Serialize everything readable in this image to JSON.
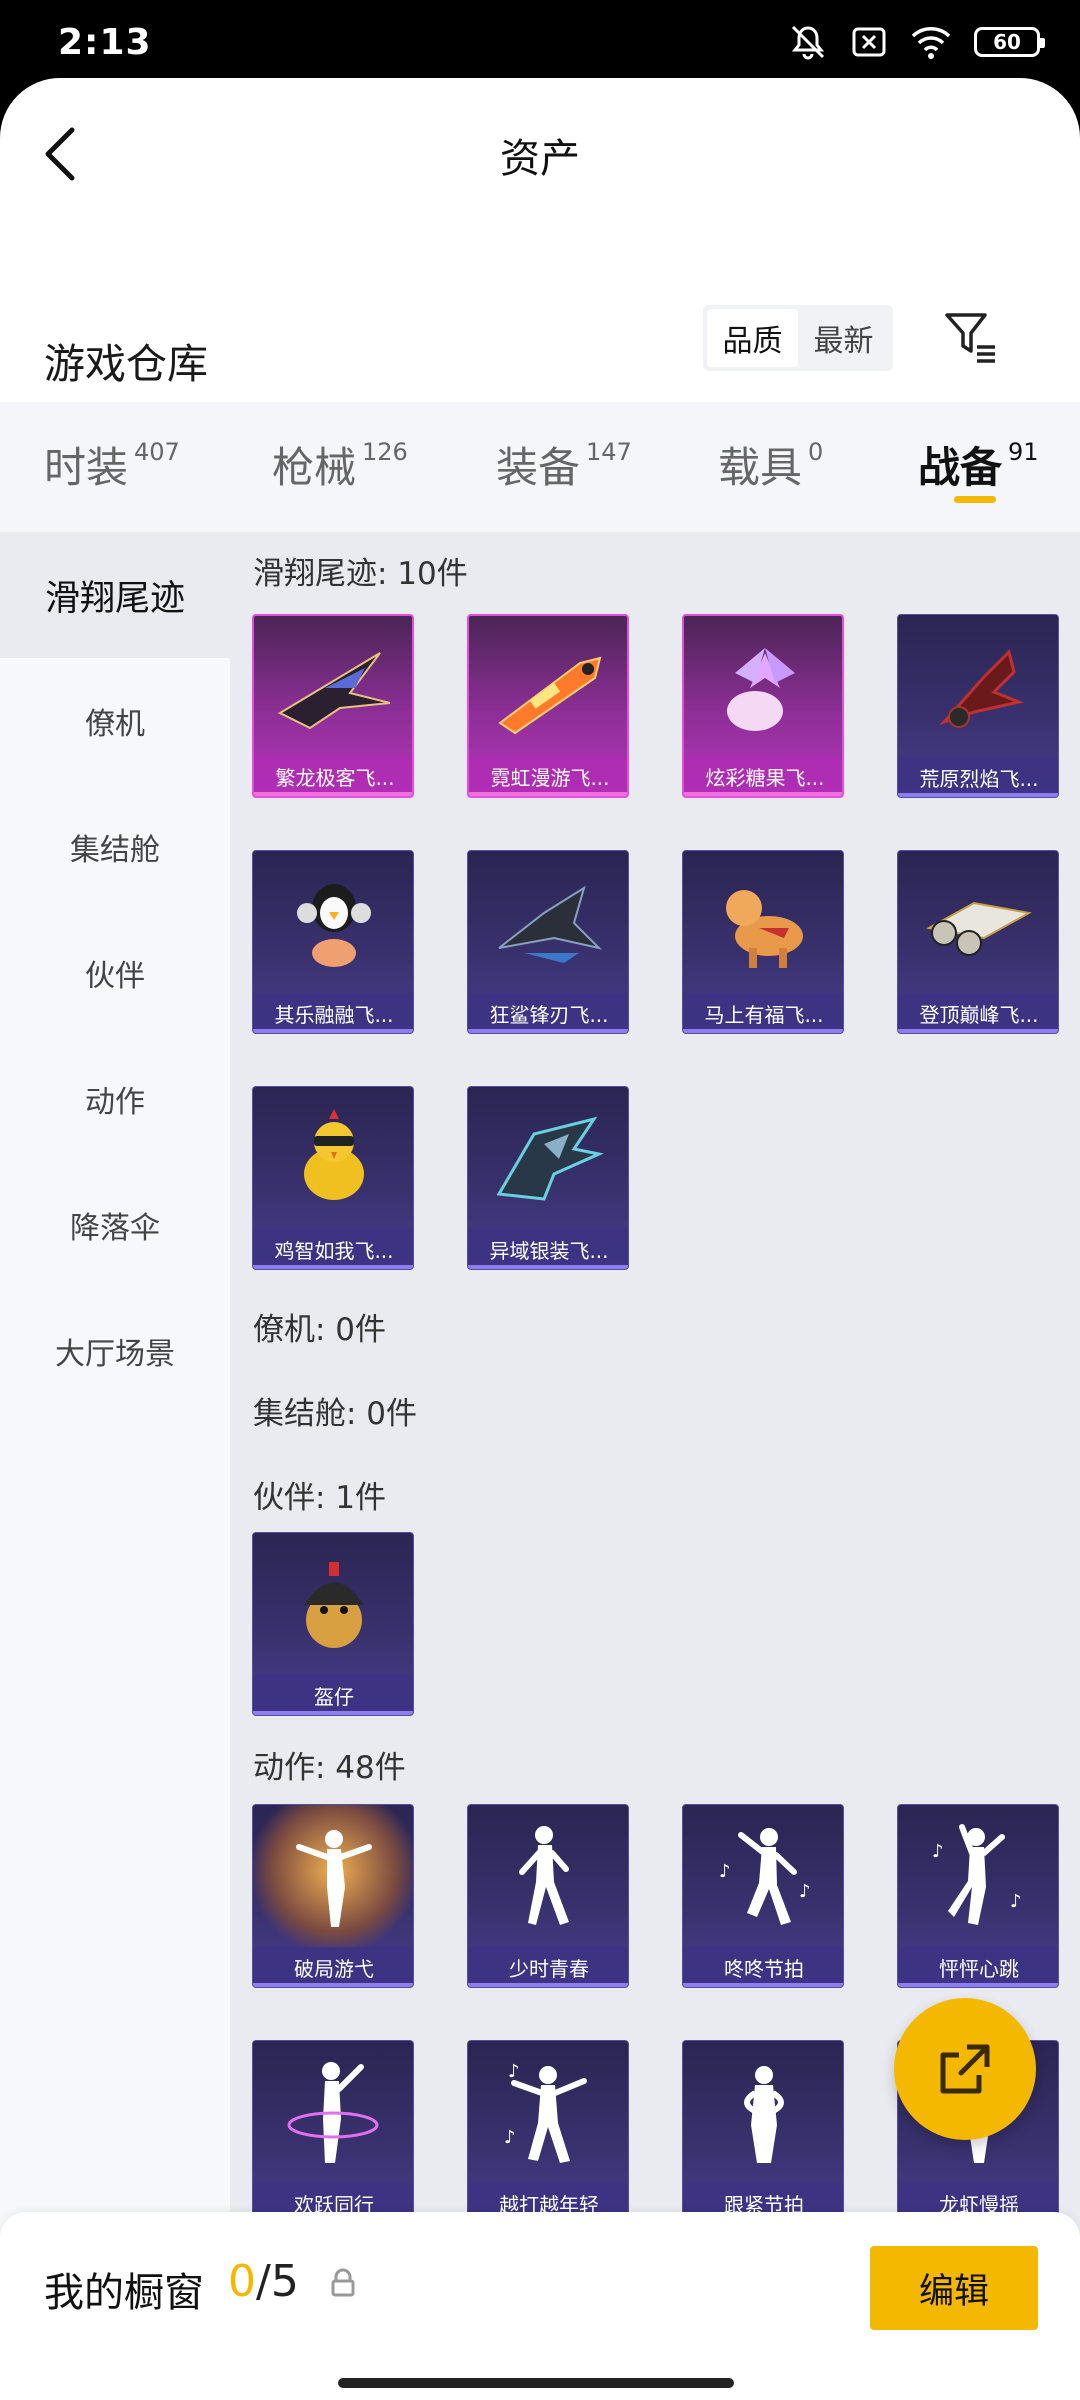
{
  "status_bar": {
    "time": "2:13",
    "battery": "60"
  },
  "header": {
    "title": "资产"
  },
  "warehouse": {
    "title": "游戏仓库",
    "sort_options": [
      "品质",
      "最新"
    ],
    "sort_active": "品质"
  },
  "tabs": [
    {
      "label": "时装",
      "count": "407"
    },
    {
      "label": "枪械",
      "count": "126"
    },
    {
      "label": "装备",
      "count": "147"
    },
    {
      "label": "载具",
      "count": "0"
    },
    {
      "label": "战备",
      "count": "91",
      "active": true
    }
  ],
  "sidebar": [
    {
      "label": "滑翔尾迹",
      "active": true
    },
    {
      "label": "僚机"
    },
    {
      "label": "集结舱"
    },
    {
      "label": "伙伴"
    },
    {
      "label": "动作"
    },
    {
      "label": "降落伞"
    },
    {
      "label": "大厅场景"
    }
  ],
  "sections": [
    {
      "title": "滑翔尾迹: 10件"
    },
    {
      "title": "僚机: 0件"
    },
    {
      "title": "集结舱: 0件"
    },
    {
      "title": "伙伴: 1件"
    },
    {
      "title": "动作: 48件"
    }
  ],
  "glide_items": [
    {
      "label": "繁龙极客飞...",
      "rarity": "pink",
      "icon": "dragon-glider-icon"
    },
    {
      "label": "霓虹漫游飞...",
      "rarity": "pink",
      "icon": "neon-rocket-icon"
    },
    {
      "label": "炫彩糖果飞...",
      "rarity": "pink",
      "icon": "candy-glider-icon"
    },
    {
      "label": "荒原烈焰飞...",
      "rarity": "purple",
      "icon": "flame-glider-icon"
    },
    {
      "label": "其乐融融飞...",
      "rarity": "purple",
      "icon": "penguin-glider-icon"
    },
    {
      "label": "狂鲨锋刃飞...",
      "rarity": "purple",
      "icon": "shark-glider-icon"
    },
    {
      "label": "马上有福飞...",
      "rarity": "purple",
      "icon": "horse-glider-icon"
    },
    {
      "label": "登顶巅峰飞...",
      "rarity": "purple",
      "icon": "jet-glider-icon"
    },
    {
      "label": "鸡智如我飞...",
      "rarity": "purple",
      "icon": "chicken-glider-icon"
    },
    {
      "label": "异域银装飞...",
      "rarity": "purple",
      "icon": "silver-glider-icon"
    }
  ],
  "partner_items": [
    {
      "label": "盔仔",
      "rarity": "purple",
      "icon": "helmet-chick-icon"
    }
  ],
  "emote_items": [
    {
      "label": "破局游弋",
      "icon": "winged-dancer-icon"
    },
    {
      "label": "少时青春",
      "icon": "dancer-icon"
    },
    {
      "label": "咚咚节拍",
      "icon": "dancer-music-icon"
    },
    {
      "label": "怦怦心跳",
      "icon": "dancer-music-icon"
    },
    {
      "label": "欢跃同行",
      "icon": "dancer-ring-icon"
    },
    {
      "label": "越打越年轻",
      "icon": "dancer-music-icon"
    },
    {
      "label": "跟紧节拍",
      "icon": "dancer-icon"
    },
    {
      "label": "龙虾慢摇",
      "icon": "dancer-icon"
    }
  ],
  "showcase": {
    "label": "我的橱窗",
    "current": "0",
    "total": "/5",
    "edit_label": "编辑"
  },
  "colors": {
    "accent": "#f5b800",
    "pink_card": "#b535b9",
    "purple_card": "#3a3270"
  }
}
